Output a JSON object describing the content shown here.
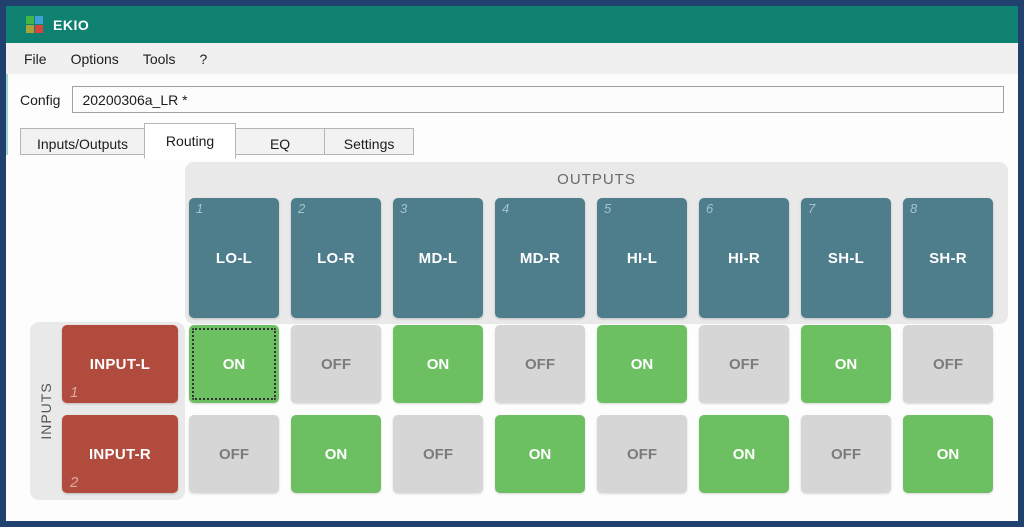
{
  "window": {
    "title": "EKIO"
  },
  "logo": {
    "colors": [
      "#43b649",
      "#3f9fd8",
      "#a8a23b",
      "#d9453a"
    ]
  },
  "menu": {
    "items": [
      "File",
      "Options",
      "Tools",
      "?"
    ]
  },
  "config": {
    "label": "Config",
    "value": "20200306a_LR *"
  },
  "tabs": [
    {
      "label": "Inputs/Outputs",
      "active": false
    },
    {
      "label": "Routing",
      "active": true
    },
    {
      "label": "EQ",
      "active": false
    },
    {
      "label": "Settings",
      "active": false
    }
  ],
  "routing": {
    "outputs_title": "OUTPUTS",
    "inputs_title": "INPUTS",
    "outputs": [
      {
        "num": "1",
        "label": "LO-L"
      },
      {
        "num": "2",
        "label": "LO-R"
      },
      {
        "num": "3",
        "label": "MD-L"
      },
      {
        "num": "4",
        "label": "MD-R"
      },
      {
        "num": "5",
        "label": "HI-L"
      },
      {
        "num": "6",
        "label": "HI-R"
      },
      {
        "num": "7",
        "label": "SH-L"
      },
      {
        "num": "8",
        "label": "SH-R"
      }
    ],
    "inputs": [
      {
        "num": "1",
        "label": "INPUT-L"
      },
      {
        "num": "2",
        "label": "INPUT-R"
      }
    ],
    "cells": [
      [
        "ON",
        "OFF",
        "ON",
        "OFF",
        "ON",
        "OFF",
        "ON",
        "OFF"
      ],
      [
        "OFF",
        "ON",
        "OFF",
        "ON",
        "OFF",
        "ON",
        "OFF",
        "ON"
      ]
    ],
    "focused_cell": {
      "row": 0,
      "col": 0
    }
  },
  "colors": {
    "titlebar": "#0e8170",
    "window_border": "#20406d",
    "output_header": "#4e7d8c",
    "input_header": "#b04b3e",
    "cell_on": "#6cc061",
    "cell_off": "#d6d6d6"
  }
}
